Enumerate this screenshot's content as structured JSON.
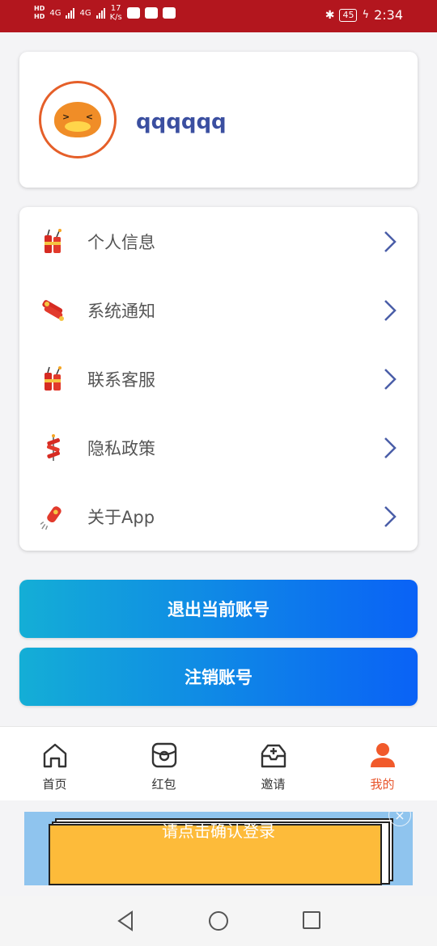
{
  "status_bar": {
    "hd1": "HD",
    "hd2": "HD",
    "net1": "4G",
    "net2": "4G",
    "speed_value": "17",
    "speed_unit": "K/s",
    "battery": "45",
    "time": "2:34"
  },
  "profile": {
    "username": "qqqqqq"
  },
  "menu": {
    "items": [
      {
        "label": "个人信息",
        "icon": "firecracker-icon"
      },
      {
        "label": "系统通知",
        "icon": "firecracker-bundle-icon"
      },
      {
        "label": "联系客服",
        "icon": "firecracker-icon"
      },
      {
        "label": "隐私政策",
        "icon": "firework-string-icon"
      },
      {
        "label": "关于App",
        "icon": "rocket-firework-icon"
      }
    ]
  },
  "buttons": {
    "logout": "退出当前账号",
    "cancel_account": "注销账号"
  },
  "tabbar": {
    "tabs": [
      {
        "label": "首页",
        "icon": "home-icon"
      },
      {
        "label": "红包",
        "icon": "red-packet-icon"
      },
      {
        "label": "邀请",
        "icon": "invite-inbox-icon"
      },
      {
        "label": "我的",
        "icon": "user-icon"
      }
    ],
    "active_color": "#e8542a"
  },
  "ad": {
    "text": "请点击确认登录"
  },
  "colors": {
    "status_bar": "#b3161e",
    "username": "#3b4fa0",
    "button_gradient_start": "#14aed6",
    "button_gradient_end": "#0a62f6",
    "chevron": "#4a5ea8"
  }
}
